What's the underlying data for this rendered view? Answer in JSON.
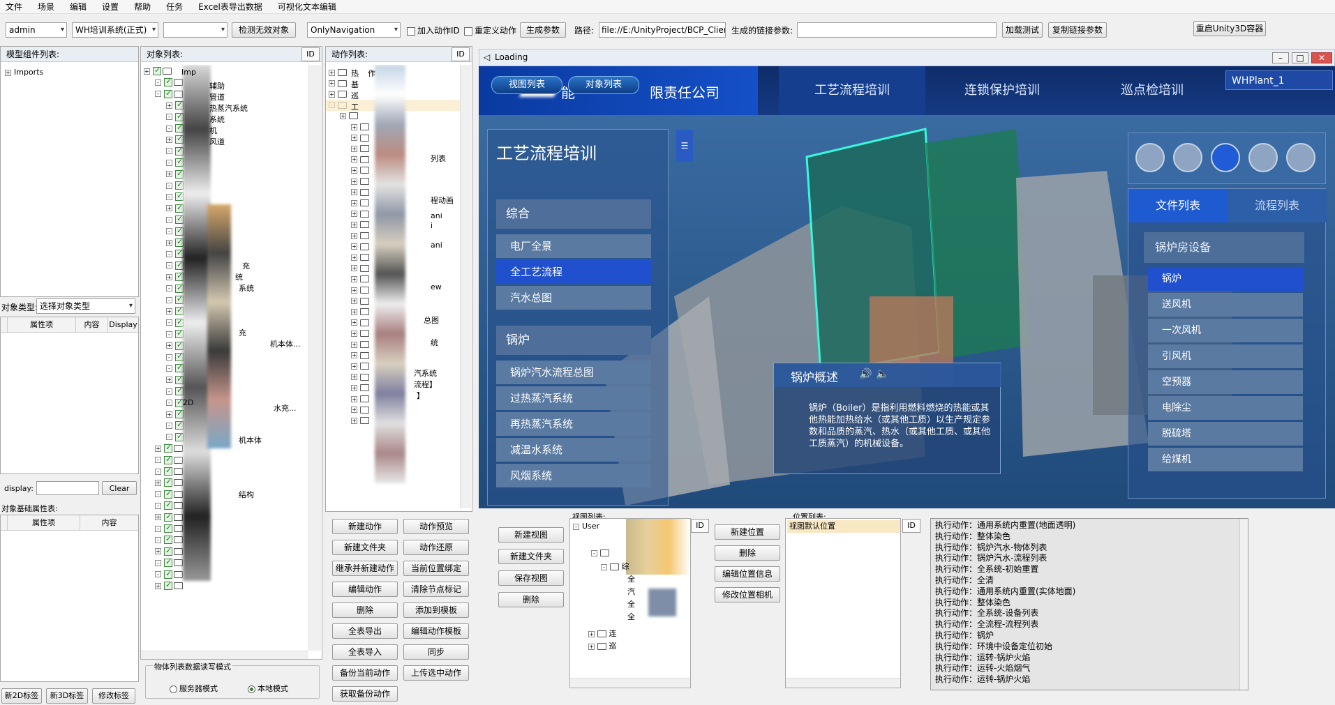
{
  "menu": [
    "文件",
    "场景",
    "编辑",
    "设置",
    "帮助",
    "任务",
    "Excel表导出数据",
    "可视化文本编辑"
  ],
  "toolbar": {
    "user": "admin",
    "system": "WH培训系统(正式)",
    "detect_invalid": "检测无效对象",
    "nav_mode": "OnlyNavigation",
    "add_action_id": "加入动作ID",
    "redefine_action": "重定义动作",
    "gen_params": "生成参数",
    "path_label": "路径:",
    "path_value": "file://E:/UnityProject/BCP_Client_W",
    "link_label": "生成的链接参数:",
    "load_test": "加载测试",
    "copy_link": "复制链接参数",
    "restart_unity": "重启Unity3D容器"
  },
  "left": {
    "model_list": "模型组件列表:",
    "imports": "Imports",
    "object_type_label": "对象类型:",
    "object_type_value": "选择对象类型",
    "attr_headers": [
      "属性项",
      "内容",
      "Display"
    ],
    "display_label": "display:",
    "clear": "Clear",
    "base_attr_label": "对象基础属性表:",
    "base_attr_headers": [
      "属性项",
      "内容"
    ],
    "bottom_buttons": [
      "新2D标签",
      "新3D标签",
      "修改标签"
    ]
  },
  "object_list": {
    "title": "对象列表:",
    "id": "ID",
    "root": "Imp",
    "visible_labels": [
      "辅助",
      "管道",
      "热蒸汽系统",
      "系统",
      "机",
      "风道",
      "充",
      "统",
      "系统",
      "充",
      "机本体...",
      "水充...",
      "2D",
      "机本体",
      "结构"
    ],
    "mode_title": "物体列表数据读写模式",
    "mode_server": "服务器模式",
    "mode_local": "本地模式"
  },
  "action_list": {
    "title": "动作列表:",
    "id": "ID",
    "visible_labels": [
      "热",
      "作",
      "基",
      "巡",
      "工",
      "列表",
      "程动画",
      "ani",
      "i",
      "ani",
      "ew",
      "总图",
      "统",
      "汽系统",
      "流程】",
      "】"
    ],
    "buttons": [
      [
        "新建动作",
        "动作预览"
      ],
      [
        "新建文件夹",
        "动作还原"
      ],
      [
        "继承并新建动作",
        "当前位置绑定"
      ],
      [
        "编辑动作",
        "清除节点标记"
      ],
      [
        "删除",
        "添加到模板"
      ],
      [
        "全表导出",
        "编辑动作模板"
      ],
      [
        "全表导入",
        "同步"
      ],
      [
        "备份当前动作",
        "上传选中动作"
      ],
      [
        "获取备份动作"
      ]
    ]
  },
  "view": {
    "view_list_label": "视图列表:",
    "buttons": [
      "新建视图",
      "新建文件夹",
      "保存视图",
      "删除"
    ],
    "root": "User",
    "node": "综",
    "id": "ID",
    "tree_tail": [
      "全",
      "汽",
      "全",
      "全",
      "连",
      "巡"
    ]
  },
  "position": {
    "label": "位置列表:",
    "buttons": [
      "新建位置",
      "删除",
      "编辑位置信息",
      "修改位置相机"
    ],
    "item": "视图默认位置",
    "id": "ID"
  },
  "game": {
    "window_title": "Loading",
    "company": "限责任公司",
    "company_prefix": "能",
    "tabs": [
      "视图列表",
      "对象列表"
    ],
    "nav": [
      "工艺流程培训",
      "连锁保护培训",
      "巡点检培训"
    ],
    "plant": "WHPlant_1",
    "left_title": "工艺流程培训",
    "sections": [
      {
        "name": "综合",
        "items": [
          "电厂全景",
          "全工艺流程",
          "汽水总图"
        ],
        "active": 1
      },
      {
        "name": "锅炉",
        "items": [
          "锅炉汽水流程总图",
          "过热蒸汽系统",
          "再热蒸汽系统",
          "减温水系统",
          "风烟系统"
        ],
        "active": -1
      }
    ],
    "right_tabs": [
      "文件列表",
      "流程列表"
    ],
    "group": "锅炉房设备",
    "equip": [
      "锅炉",
      "送风机",
      "一次风机",
      "引风机",
      "空预器",
      "电除尘",
      "脱硫塔",
      "给煤机"
    ],
    "info_title": "锅炉概述",
    "info_text": "锅炉（Boiler）是指利用燃料燃烧的热能或其他热能加热给水（或其他工质）以生产规定参数和品质的蒸汽、热水（或其他工质、或其他工质蒸汽）的机械设备。"
  },
  "log": [
    "执行动作：通用系统内重置(地面透明)",
    "执行动作：整体染色",
    "执行动作：锅炉汽水-物体列表",
    "执行动作：锅炉汽水-流程列表",
    "执行动作：全系统-初始重置",
    "执行动作：全清",
    "执行动作：通用系统内重置(实体地面)",
    "执行动作：整体染色",
    "执行动作：全系统-设备列表",
    "执行动作：全流程-流程列表",
    "执行动作：锅炉",
    "执行动作：环境中设备定位初始",
    "执行动作：运转-锅炉火焰",
    "执行动作：运转-火焰烟气",
    "执行动作：运转-锅炉火焰"
  ]
}
